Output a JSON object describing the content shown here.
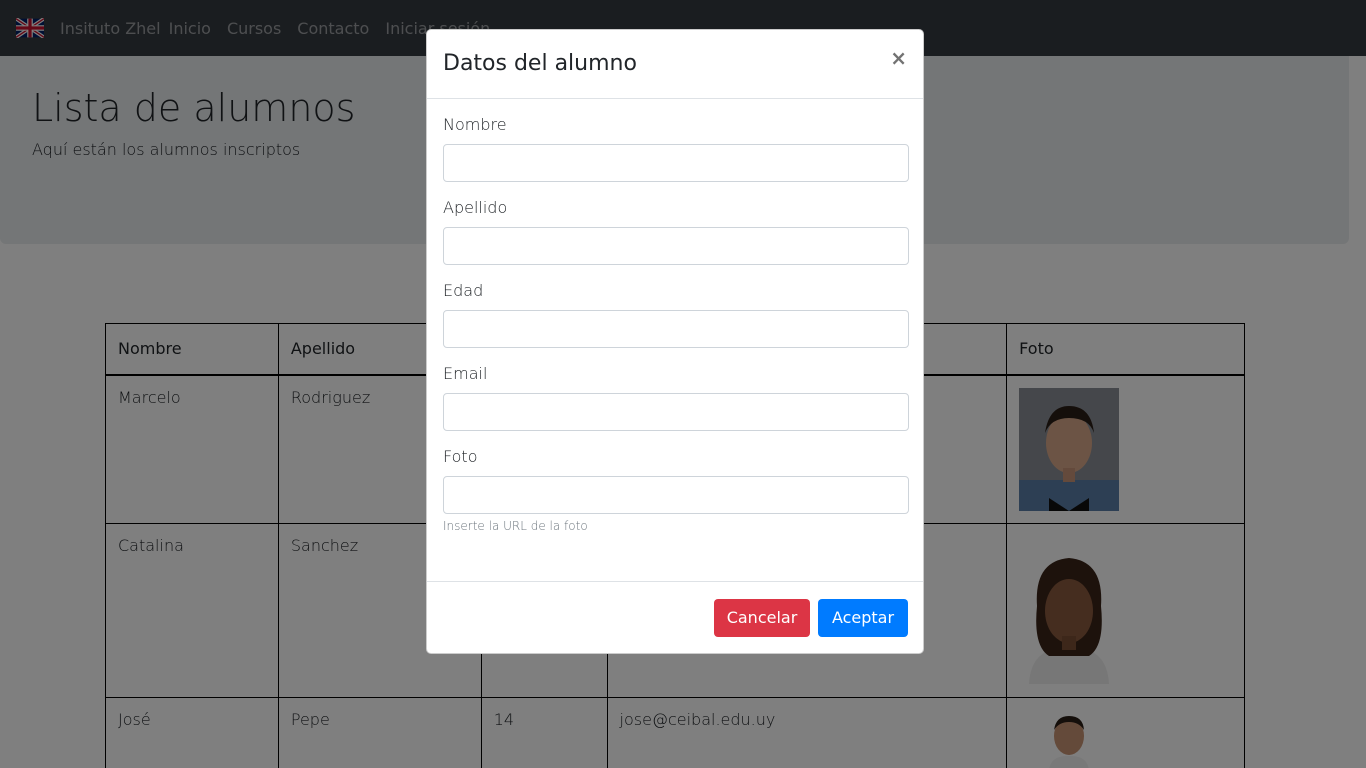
{
  "navbar": {
    "brand": "Insituto Zhel",
    "links": [
      "Inicio",
      "Cursos",
      "Contacto",
      "Iniciar sesión"
    ],
    "flag_icon": "uk-flag-icon"
  },
  "jumbotron": {
    "title": "Lista de alumnos",
    "subtitle": "Aquí están los alumnos inscriptos"
  },
  "table": {
    "headers": [
      "Nombre",
      "Apellido",
      "",
      "",
      "Foto"
    ],
    "rows": [
      {
        "nombre": "Marcelo",
        "apellido": "Rodriguez",
        "edad": "",
        "email": ""
      },
      {
        "nombre": "Catalina",
        "apellido": "Sanchez",
        "edad": "",
        "email": ""
      },
      {
        "nombre": "José",
        "apellido": "Pepe",
        "edad": "14",
        "email": "jose@ceibal.edu.uy"
      }
    ]
  },
  "modal": {
    "title": "Datos del alumno",
    "close_symbol": "×",
    "fields": [
      {
        "label": "Nombre",
        "value": ""
      },
      {
        "label": "Apellido",
        "value": ""
      },
      {
        "label": "Edad",
        "value": ""
      },
      {
        "label": "Email",
        "value": ""
      },
      {
        "label": "Foto",
        "value": "",
        "help": "Inserte la URL de la foto"
      }
    ],
    "cancel_label": "Cancelar",
    "accept_label": "Aceptar"
  },
  "colors": {
    "navbar": "#343a40",
    "jumbotron": "#e9ecef",
    "danger": "#dc3545",
    "primary": "#007bff"
  }
}
